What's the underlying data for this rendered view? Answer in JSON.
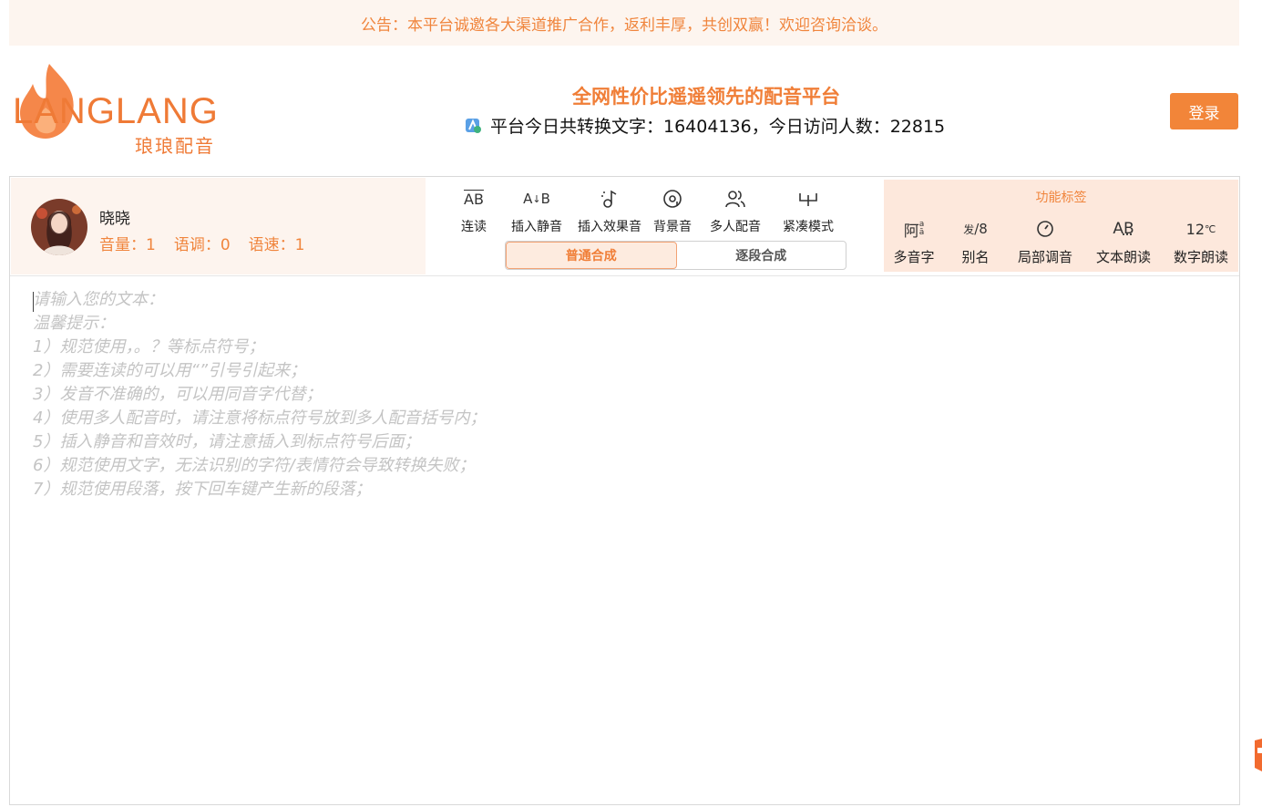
{
  "notice": "公告：本平台诚邀各大渠道推广合作，返利丰厚，共创双赢！欢迎咨询洽谈。",
  "brand": {
    "logo_text": "LANGLANG",
    "logo_sub": "琅琅配音",
    "accent_color": "#f07e37"
  },
  "header": {
    "slogan": "全网性价比遥遥领先的配音平台",
    "stats_text": "平台今日共转换文字：16404136，今日访问人数：22815",
    "login_label": "登录"
  },
  "voice": {
    "name": "晓晓",
    "volume": "音量：1",
    "pitch": "语调：0",
    "speed": "语速：1"
  },
  "tools": [
    {
      "label": "连读",
      "icon": "AB"
    },
    {
      "label": "插入静音",
      "icon": "A↓B"
    },
    {
      "label": "插入效果音",
      "icon": "music-note-icon"
    },
    {
      "label": "背景音",
      "icon": "disc-icon"
    },
    {
      "label": "多人配音",
      "icon": "users-icon"
    },
    {
      "label": "紧凑模式",
      "icon": "compact-icon"
    }
  ],
  "modes": {
    "normal": "普通合成",
    "segment": "逐段合成",
    "active": "普通合成"
  },
  "func_panel": {
    "title": "功能标签",
    "items": [
      {
        "label": "多音字",
        "icon": "阿"
      },
      {
        "label": "别名",
        "icon": "发/8"
      },
      {
        "label": "局部调音",
        "icon": "dial-icon"
      },
      {
        "label": "文本朗读",
        "icon": "AB"
      },
      {
        "label": "数字朗读",
        "icon": "12℃"
      }
    ]
  },
  "editor": {
    "lines": [
      "请输入您的文本：",
      "",
      "温馨提示：",
      "1）规范使用，。？等标点符号；",
      "2）需要连读的可以用“”引号引起来；",
      "3）发音不准确的，可以用同音字代替；",
      "4）使用多人配音时，请注意将标点符号放到多人配音括号内；",
      "5）插入静音和音效时，请注意插入到标点符号后面；",
      "6）规范使用文字，无法识别的字符/表情符会导致转换失败；",
      "7）规范使用段落，按下回车键产生新的段落；"
    ]
  }
}
